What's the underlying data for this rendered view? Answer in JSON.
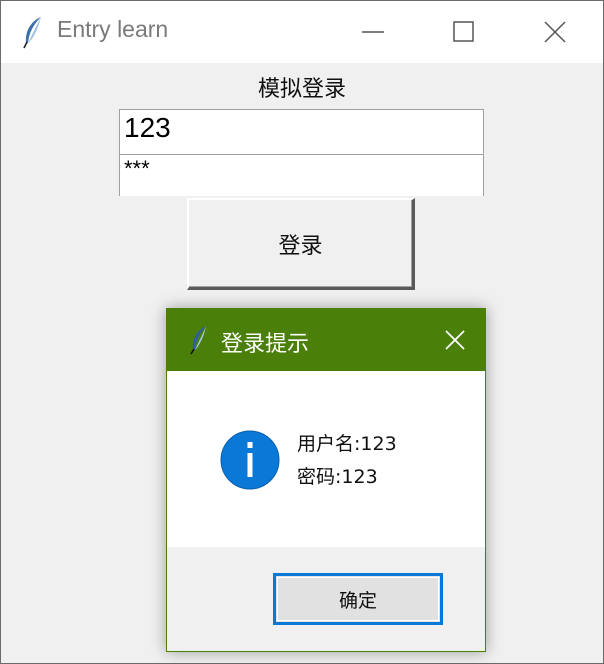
{
  "window": {
    "title": "Entry learn",
    "icon": "feather-icon"
  },
  "form": {
    "title": "模拟登录",
    "username_value": "123",
    "password_display": "***",
    "login_button_label": "登录"
  },
  "dialog": {
    "title": "登录提示",
    "icon": "info-icon",
    "message_lines": [
      "用户名:123",
      "密码:123"
    ],
    "ok_button_label": "确定"
  },
  "colors": {
    "dialog_titlebar": "#4a7f0a",
    "info_icon": "#0a78d7",
    "ok_button_border": "#0a78d7"
  }
}
